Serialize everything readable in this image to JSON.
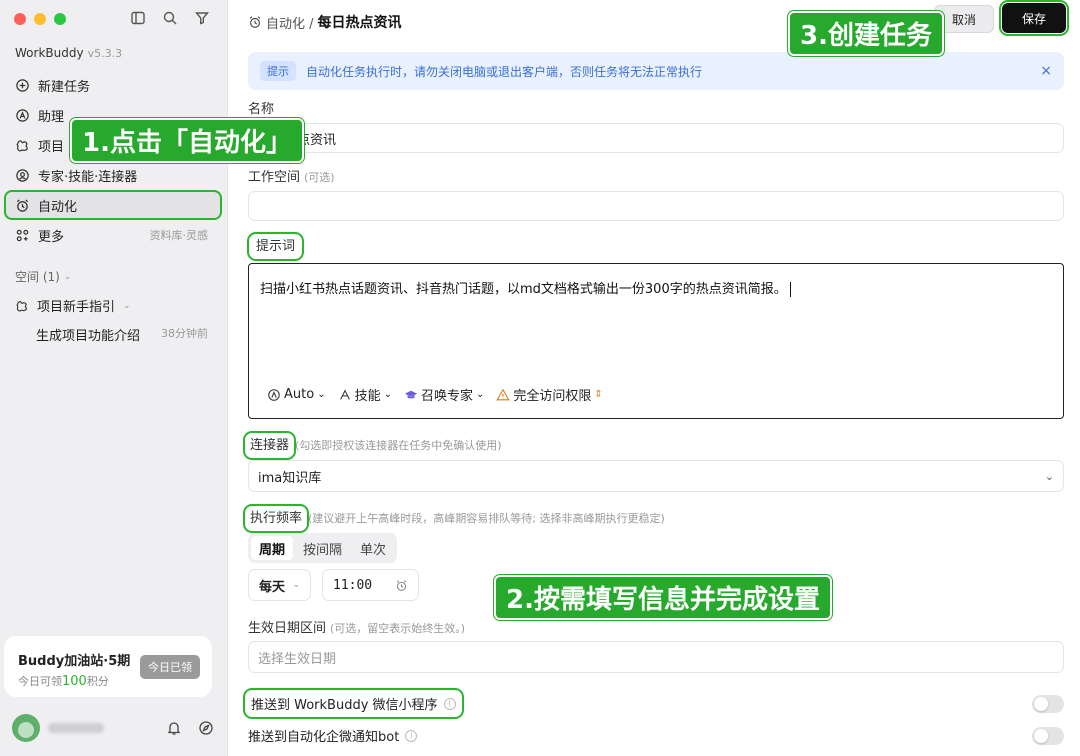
{
  "sidebar": {
    "brand": "WorkBuddy",
    "version": "v5.3.3",
    "items": [
      {
        "label": "新建任务",
        "icon": "plus-bubble-icon"
      },
      {
        "label": "助理",
        "icon": "assistant-icon"
      },
      {
        "label": "项目",
        "icon": "project-icon"
      },
      {
        "label": "专家·技能·连接器",
        "icon": "expert-icon"
      },
      {
        "label": "自动化",
        "icon": "alarm-clock-icon",
        "active": true
      },
      {
        "label": "更多",
        "icon": "grid-icon",
        "right": "资料库·灵感"
      }
    ],
    "space_label": "空间 (1)",
    "project_label": "项目新手指引",
    "sub_item": {
      "label": "生成项目功能介绍",
      "time": "38分钟前"
    },
    "promo": {
      "title": "Buddy加油站·5期",
      "line_prefix": "今日可领",
      "points": "100",
      "line_suffix": "积分",
      "button": "今日已领"
    }
  },
  "header": {
    "breadcrumb_parent": "自动化 /",
    "breadcrumb_current": "每日热点资讯",
    "cancel": "取消",
    "save": "保存"
  },
  "notice": {
    "tag": "提示",
    "message": "自动化任务执行时，请勿关闭电脑或退出客户端，否则任务将无法正常执行",
    "close": "×"
  },
  "form": {
    "name_label": "名称",
    "name_value": "每日热点资讯",
    "workspace_label": "工作空间",
    "workspace_hint": "(可选)",
    "workspace_value": "",
    "prompt_label": "提示词",
    "prompt_value": "扫描小红书热点话题资讯、抖音热门话题，以md文档格式输出一份300字的热点资讯简报。",
    "prompt_tools": {
      "auto": "Auto",
      "skills": "技能",
      "experts": "召唤专家",
      "access": "完全访问权限"
    },
    "connector_label": "连接器",
    "connector_hint": "(勾选即授权该连接器在任务中免确认使用)",
    "connector_value": "ima知识库",
    "freq_label": "执行频率",
    "freq_hint": "(建议避开上午高峰时段，高峰期容易排队等待; 选择非高峰期执行更稳定)",
    "freq_tabs": [
      "周期",
      "按间隔",
      "单次"
    ],
    "freq_selected": "周期",
    "freq_unit": "每天",
    "freq_time": "11:00",
    "date_label": "生效日期区间",
    "date_hint": "(可选，留空表示始终生效。)",
    "date_placeholder": "选择生效日期",
    "push_wechat": "推送到 WorkBuddy 微信小程序",
    "push_wecom": "推送到自动化企微通知bot"
  },
  "callouts": {
    "step1": "1.点击「自动化」",
    "step2": "2.按需填写信息并完成设置",
    "step3": "3.创建任务"
  },
  "colors": {
    "accent_green": "#2bb52f",
    "notice_blue": "#3a6fd8",
    "save_bg": "#111111"
  }
}
